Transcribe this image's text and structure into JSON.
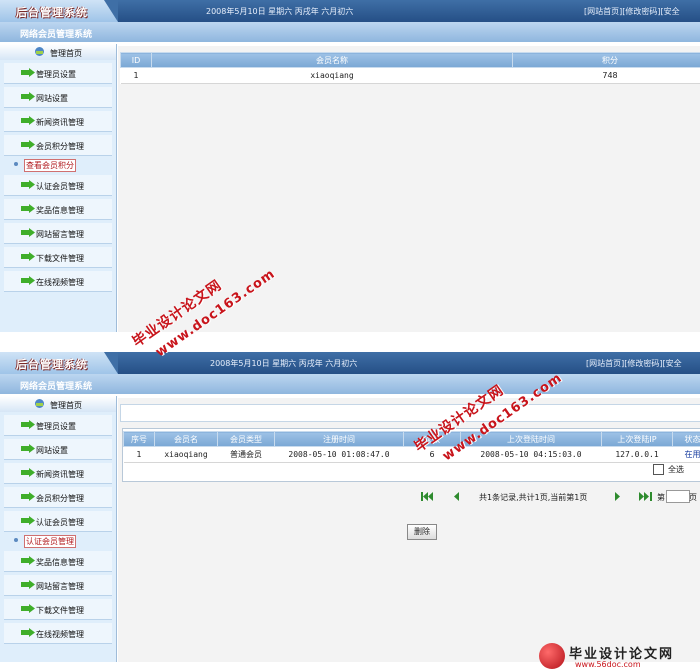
{
  "header": {
    "logo_text": "后台管理系统",
    "date_text": "2008年5月10日 星期六 丙戌年 六月初六",
    "links": [
      "[网站首页]",
      "[修改密码]",
      "[安全"
    ],
    "subtitle": "网络会员管理系统"
  },
  "sidebar": {
    "home_label": "管理首页",
    "items_panel1": [
      "管理员设置",
      "网站设置",
      "新闻资讯管理",
      "会员积分管理"
    ],
    "active_panel1": "查看会员积分",
    "items_panel1_after": [
      "认证会员管理",
      "奖品信息管理",
      "网站留言管理",
      "下载文件管理",
      "在线视频管理"
    ],
    "items_panel2": [
      "管理员设置",
      "网站设置",
      "新闻资讯管理",
      "会员积分管理",
      "认证会员管理"
    ],
    "active_panel2": "认证会员管理",
    "items_panel2_after": [
      "奖品信息管理",
      "网站留言管理",
      "下载文件管理",
      "在线视频管理"
    ]
  },
  "points_table": {
    "headers": [
      "ID",
      "会员名称",
      "积分"
    ],
    "rows": [
      [
        "1",
        "xiaoqiang",
        "748"
      ]
    ]
  },
  "member_table": {
    "headers": [
      "序号",
      "会员名",
      "会员类型",
      "注册时间",
      "次数",
      "上次登陆时间",
      "上次登陆IP",
      "状态"
    ],
    "rows": [
      [
        "1",
        "xiaoqiang",
        "普通会员",
        "2008-05-10 01:08:47.0",
        "6",
        "2008-05-10 04:15:03.0",
        "127.0.0.1",
        "在用"
      ]
    ],
    "select_all_label": "全选"
  },
  "pager": {
    "info": "共1条记录,共计1页,当前第1页",
    "page_prefix": "第",
    "page_suffix": "页",
    "page_value": ""
  },
  "delete_button": "删除",
  "watermarks": {
    "cn": "毕业设计论文网",
    "url": "www.doc163.com"
  },
  "footer_logo": {
    "title": "毕业设计论文网",
    "url": "www.56doc.com"
  },
  "colors": {
    "topbar": "#254f86",
    "sidebar_bg": "#dfeefb",
    "table_header": "#7aa7d4",
    "watermark": "#c8141b",
    "active_item": "#b0181d"
  }
}
